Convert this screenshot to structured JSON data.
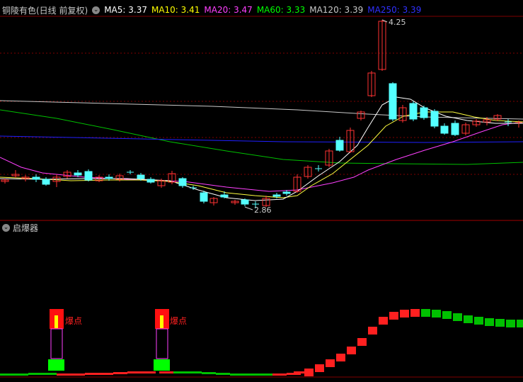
{
  "header": {
    "title": "铜陵有色(日线 前复权)",
    "ma": [
      {
        "label": "MA5: 3.37",
        "color": "#ffffff"
      },
      {
        "label": "MA10: 3.41",
        "color": "#ffff00"
      },
      {
        "label": "MA20: 3.47",
        "color": "#ff40ff"
      },
      {
        "label": "MA60: 3.33",
        "color": "#00ff00"
      },
      {
        "label": "MA120: 3.39",
        "color": "#c8c8c8"
      },
      {
        "label": "MA250: 3.39",
        "color": "#3030ff"
      }
    ]
  },
  "price_chart": {
    "high_label": "4.25",
    "low_label": "2.86",
    "up_color": "#ff3232",
    "down_color": "#54ffff"
  },
  "indicator": {
    "name": "启爆器",
    "signal_label": "爆点",
    "signal_count": 2
  },
  "chart_data": {
    "type": "candlestick",
    "title": "铜陵有色(日线 前复权)",
    "price_range": [
      2.86,
      4.25
    ],
    "annotations": [
      "4.25",
      "2.86"
    ]
  }
}
